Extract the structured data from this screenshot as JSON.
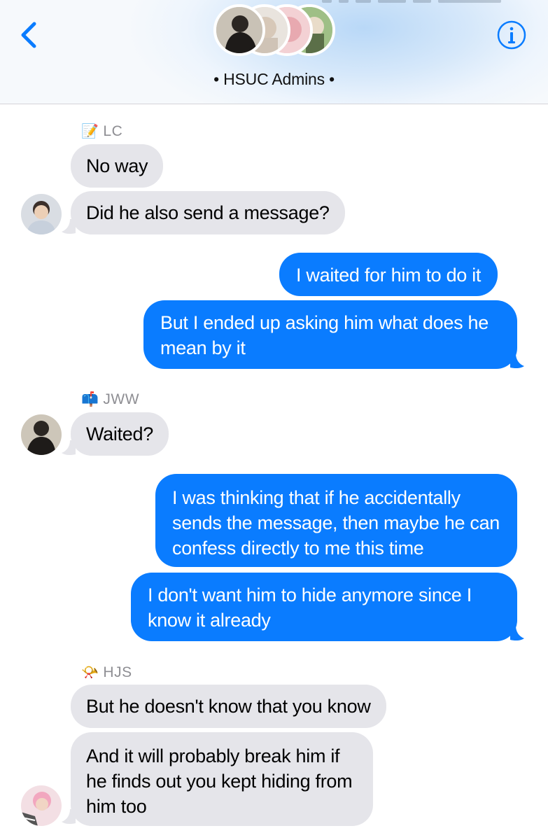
{
  "header": {
    "title": "• HSUC Admins •",
    "back_icon": "chevron-left-icon",
    "info_icon": "info-icon",
    "accent": "#0a7cff",
    "avatars": [
      "group-member-avatar-1",
      "group-member-avatar-2",
      "group-member-avatar-3",
      "group-member-avatar-4"
    ]
  },
  "messages": [
    {
      "sender": "LC",
      "sender_emoji": "📝",
      "direction": "incoming",
      "text": "No way"
    },
    {
      "direction": "incoming",
      "text": "Did he also send a message?"
    },
    {
      "direction": "outgoing",
      "text": "I waited for him to do it"
    },
    {
      "direction": "outgoing",
      "text": "But I ended up asking him what does he mean by it"
    },
    {
      "sender": "JWW",
      "sender_emoji": "📫",
      "direction": "incoming",
      "text": "Waited?"
    },
    {
      "direction": "outgoing",
      "text": "I was thinking that if he accidentally sends the message, then maybe he can confess directly to me this time"
    },
    {
      "direction": "outgoing",
      "text": "I don't want him to hide anymore since I know it already"
    },
    {
      "sender": "HJS",
      "sender_emoji": "📯",
      "direction": "incoming",
      "text": "But he doesn't know that you know"
    },
    {
      "direction": "incoming",
      "text": "And it will probably break him if he finds out you kept hiding from him too"
    }
  ],
  "colors": {
    "incoming_bubble": "#e5e5ea",
    "outgoing_bubble": "#0a7cff",
    "sender_label": "#8e8e93"
  }
}
